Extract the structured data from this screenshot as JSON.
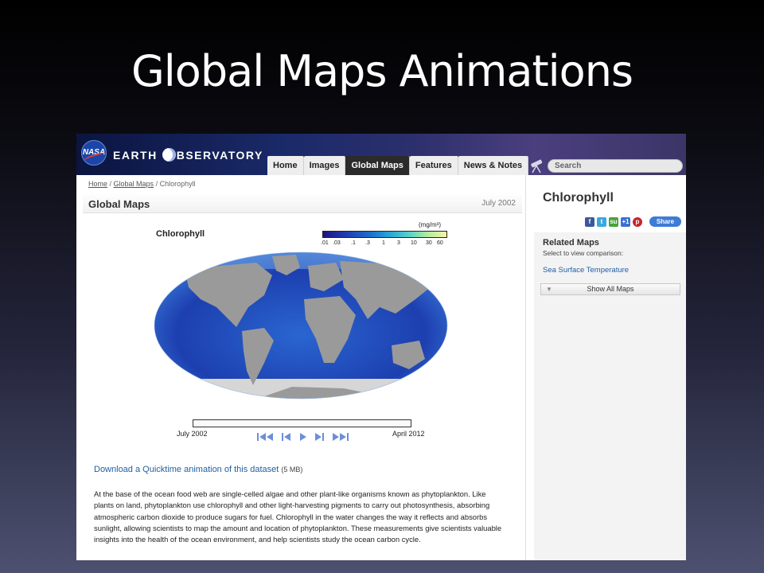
{
  "slide": {
    "title": "Global Maps Animations"
  },
  "header": {
    "logo_text": "NASA",
    "wordmark_left": "EARTH",
    "wordmark_right": "BSERVATORY",
    "nav": [
      {
        "label": "Home",
        "active": false
      },
      {
        "label": "Images",
        "active": false
      },
      {
        "label": "Global Maps",
        "active": true
      },
      {
        "label": "Features",
        "active": false
      },
      {
        "label": "News & Notes",
        "active": false
      }
    ],
    "search_placeholder": "Search"
  },
  "breadcrumb": {
    "home": "Home",
    "sep1": " / ",
    "global_maps": "Global Maps",
    "sep2": " / ",
    "current": "Chlorophyll"
  },
  "page": {
    "title": "Global Maps",
    "date": "July 2002"
  },
  "map": {
    "label": "Chlorophyll",
    "unit": "(mg/m³)",
    "scale_ticks": [
      ".01",
      ".03",
      ".1",
      ".3",
      "1",
      "3",
      "10",
      "30",
      "60"
    ],
    "colors": {
      "ocean_deep": "#1d3fb0",
      "ocean_mid": "#2a66d0",
      "land": "#9a9a9a",
      "ice": "#d6d6d6"
    }
  },
  "timeline": {
    "start": "July 2002",
    "end": "April 2012",
    "position": 0.0
  },
  "controls": [
    "first-icon",
    "previous-icon",
    "play-icon",
    "next-icon",
    "last-icon"
  ],
  "download": {
    "link": "Download a Quicktime animation of this dataset",
    "size": "(5 MB)"
  },
  "description": "At the base of the ocean food web are single-celled algae and other plant-like organisms known as phytoplankton. Like plants on land, phytoplankton use chlorophyll and other light-harvesting pigments to carry out photosynthesis, absorbing atmospheric carbon dioxide to produce sugars for fuel. Chlorophyll in the water changes the way it reflects and absorbs sunlight, allowing scientists to map the amount and location of phytoplankton. These measurements give scientists valuable insights into the health of the ocean environment, and help scientists study the ocean carbon cycle.",
  "sidebar": {
    "title": "Chlorophyll",
    "share_label": "Share",
    "share_icons": [
      {
        "icon": "facebook-icon",
        "glyph": "f",
        "color": "#3b5998"
      },
      {
        "icon": "twitter-icon",
        "glyph": "t",
        "color": "#3aa8df"
      },
      {
        "icon": "stumbleupon-icon",
        "glyph": "su",
        "color": "#48a23b"
      },
      {
        "icon": "google-plus-icon",
        "glyph": "+1",
        "color": "#3b6fd1"
      },
      {
        "icon": "pinterest-icon",
        "glyph": "p",
        "color": "#c8232c"
      }
    ],
    "related_heading": "Related Maps",
    "related_sub": "Select to view comparison:",
    "related_link": "Sea Surface Temperature",
    "show_all": "Show All Maps"
  }
}
